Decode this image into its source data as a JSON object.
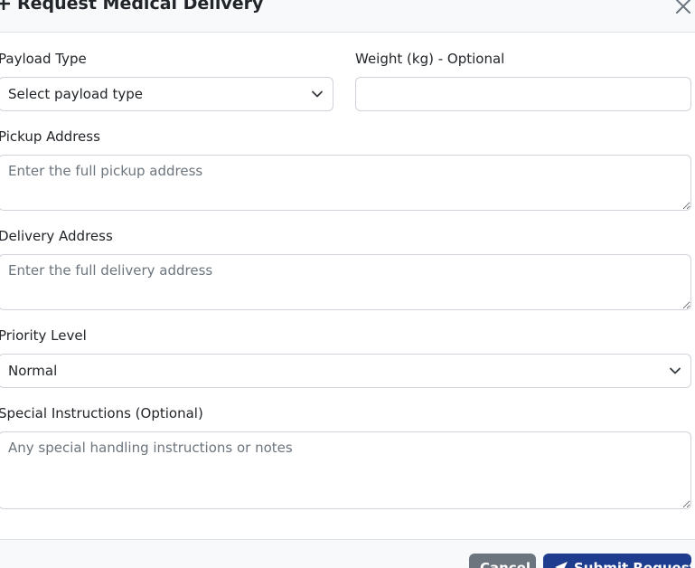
{
  "modal": {
    "title": "Request Medical Delivery",
    "icons": {
      "title": "plus-icon",
      "close": "close-icon",
      "select": "chevron-down-icon",
      "submit": "send-icon"
    }
  },
  "form": {
    "payload_type": {
      "label": "Payload Type",
      "value": "Select payload type"
    },
    "weight": {
      "label": "Weight (kg) - Optional",
      "value": ""
    },
    "pickup_address": {
      "label": "Pickup Address",
      "placeholder": "Enter the full pickup address"
    },
    "delivery_address": {
      "label": "Delivery Address",
      "placeholder": "Enter the full delivery address"
    },
    "priority": {
      "label": "Priority Level",
      "value": "Normal"
    },
    "special_instructions": {
      "label": "Special Instructions (Optional)",
      "placeholder": "Any special handling instructions or notes"
    }
  },
  "footer": {
    "cancel_label": "Cancel",
    "submit_label": "Submit Request"
  },
  "colors": {
    "header_bg": "#f8f9fa",
    "border": "#ced4da",
    "cancel_bg": "#6c757d",
    "submit_bg": "#1f3d8f"
  }
}
